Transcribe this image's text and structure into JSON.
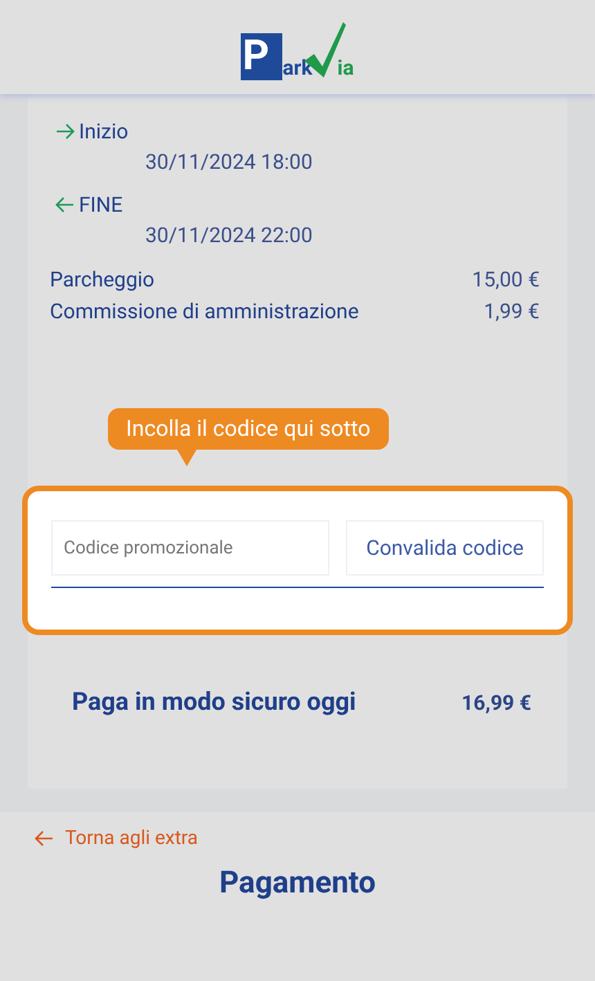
{
  "logo": {
    "letter": "P",
    "middle": "ark",
    "end": "ia"
  },
  "times": [
    {
      "kind": "start",
      "label": "Inizio",
      "value": "30/11/2024 18:00"
    },
    {
      "kind": "end",
      "label": "FINE",
      "value": "30/11/2024 22:00"
    }
  ],
  "costs": [
    {
      "label": "Parcheggio",
      "amount": "15,00 €"
    },
    {
      "label": "Commissione di amministrazione",
      "amount": "1,99 €"
    }
  ],
  "promo": {
    "tooltip": "Incolla il codice qui sotto",
    "placeholder": "Codice promozionale",
    "button": "Convalida codice"
  },
  "total": {
    "label": "Paga in modo sicuro oggi",
    "amount": "16,99 €"
  },
  "back_link": "Torna agli extra",
  "page_title": "Pagamento"
}
